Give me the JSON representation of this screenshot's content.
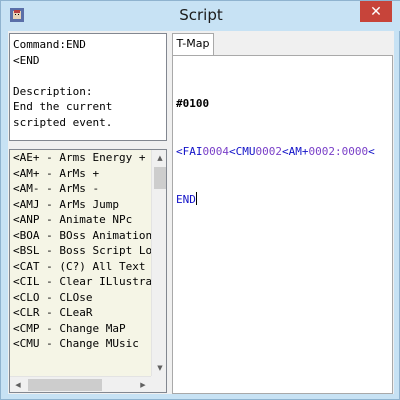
{
  "window": {
    "title": "Script",
    "close_glyph": "✕",
    "app_icon": "program-icon"
  },
  "description_panel": {
    "text": "Command:END\n<END\n\nDescription:\nEnd the current\nscripted event."
  },
  "command_list": {
    "items": [
      "<AE+ - Arms Energy +",
      "<AM+ - ArMs +",
      "<AM- - ArMs -",
      "<AMJ - ArMs Jump",
      "<ANP - Animate NPc",
      "<BOA - BOss Animation",
      "<BSL - Boss Script Load",
      "<CAT - (C?) All Text",
      "<CIL - Clear ILlustration",
      "<CLO - CLOse",
      "<CLR - CLeaR",
      "<CMP - Change MaP",
      "<CMU - Change MUsic"
    ]
  },
  "tabs": [
    {
      "label": "T-Map",
      "selected": true
    }
  ],
  "editor": {
    "header": "#0100",
    "line2": [
      {
        "text": "<FAI",
        "kind": "cmd"
      },
      {
        "text": "0004",
        "kind": "num"
      },
      {
        "text": "<CMU",
        "kind": "cmd"
      },
      {
        "text": "0002",
        "kind": "num"
      },
      {
        "text": "<AM+",
        "kind": "cmd"
      },
      {
        "text": "0002:0000",
        "kind": "num"
      },
      {
        "text": "<",
        "kind": "cmd"
      }
    ],
    "line3": "END"
  },
  "colors": {
    "command": "#1212c8",
    "number": "#7a40c8",
    "close_button": "#c7443a",
    "list_background": "#f5f5e6"
  }
}
